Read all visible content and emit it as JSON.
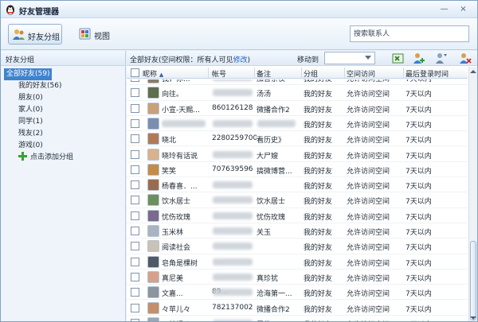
{
  "window": {
    "title": "好友管理器",
    "minimize_glyph": "—",
    "close_glyph": "×",
    "app_icon": "qq-penguin-icon"
  },
  "toolbar": {
    "group_button": {
      "label": "好友分组",
      "icon": "friend-group-icon"
    },
    "view_button": {
      "label": "视图",
      "icon": "view-icon"
    },
    "search": {
      "placeholder": "搜索联系人"
    }
  },
  "sidebar": {
    "heading": "好友分组",
    "groups": [
      {
        "label": "全部好友(59)",
        "selected": true
      },
      {
        "label": "我的好友(56)"
      },
      {
        "label": "朋友(0)"
      },
      {
        "label": "家人(0)"
      },
      {
        "label": "同学(1)"
      },
      {
        "label": "残友(2)"
      },
      {
        "label": "游戏(0)"
      }
    ],
    "add_group_label": "点击添加分组"
  },
  "main": {
    "heading": "全部好友(空间权限：所有人可见",
    "edit_link": "修改",
    "heading_close": ")",
    "move_to_label": "移动到",
    "move_to_value": "",
    "action_icons": [
      "export-excel-icon",
      "add-friend-icon",
      "friend-settings-icon",
      "delete-friend-icon"
    ],
    "columns": {
      "nickname": "昵称",
      "account": "帐号",
      "note": "备注",
      "group": "分组",
      "permission": "空间访问",
      "last_login": "最后登录时间"
    },
    "rows": [
      {
        "nickname": "我，你...",
        "account": "",
        "note": "加普亲仅",
        "group": "我的好友",
        "permission": "允许访问空间",
        "last_login": "7天以内",
        "blur_account": true
      },
      {
        "nickname": "向往。",
        "account": "",
        "note": "汤汤",
        "group": "我的好友",
        "permission": "允许访问空间",
        "last_login": "7天以内",
        "blur_account": true
      },
      {
        "nickname": "小宣-天赐...",
        "account": "860126128",
        "note": "微播合作2",
        "group": "我的好友",
        "permission": "允许访问空间",
        "last_login": "7天以内"
      },
      {
        "nickname": "",
        "account": "",
        "note": "",
        "group": "我的好友",
        "permission": "允许访问空间",
        "last_login": "7天以内",
        "blur_nick": true,
        "blur_account": true,
        "blur_note": true
      },
      {
        "nickname": "晓北",
        "account": "2280259700",
        "note": "看历史》",
        "group": "我的好友",
        "permission": "允许访问空间",
        "last_login": "7天以内"
      },
      {
        "nickname": "晓玲有话说",
        "account": "",
        "note": "大尸嫂",
        "group": "我的好友",
        "permission": "允许访问空间",
        "last_login": "7天以内",
        "blur_account": true
      },
      {
        "nickname": "笑笑",
        "account": "707639596",
        "note": "搞微博营...",
        "group": "我的好友",
        "permission": "允许访问空间",
        "last_login": "7天以内"
      },
      {
        "nickname": "杨春喜．...",
        "account": "",
        "note": "",
        "group": "我的好友",
        "permission": "允许访问空间",
        "last_login": "7天以内",
        "blur_account": true
      },
      {
        "nickname": "饮水居士",
        "account": "",
        "note": "饮水居士",
        "group": "我的好友",
        "permission": "允许访问空间",
        "last_login": "7天以内",
        "blur_account": true
      },
      {
        "nickname": "忧伤玫瑰",
        "account": "",
        "note": "忧伤玫瑰",
        "group": "我的好友",
        "permission": "允许访问空间",
        "last_login": "7天以内",
        "blur_account": true
      },
      {
        "nickname": "玉米林",
        "account": "",
        "note": "关玉",
        "group": "我的好友",
        "permission": "允许访问空间",
        "last_login": "7天以内",
        "blur_account": true
      },
      {
        "nickname": "阅读社会",
        "account": "",
        "note": "",
        "group": "我的好友",
        "permission": "允许访问空间",
        "last_login": "7天以内",
        "blur_account": true
      },
      {
        "nickname": "皂角是棵树",
        "account": "",
        "note": "",
        "group": "我的好友",
        "permission": "允许访问空间",
        "last_login": "7天以内",
        "blur_account": true
      },
      {
        "nickname": "真尼美",
        "account": "",
        "note": "真珍犹",
        "group": "我的好友",
        "permission": "允许访问空间",
        "last_login": "7天以内",
        "blur_account": true
      },
      {
        "nickname": "文嘉...",
        "account": "89...",
        "note": "沧海第一...",
        "group": "我的好友",
        "permission": "允许访问空间",
        "last_login": "7天以内",
        "blur_account": true
      },
      {
        "nickname": "々苹儿々",
        "account": "782137002",
        "note": "微播合作2",
        "group": "我的好友",
        "permission": "允许访问空间",
        "last_login": "7天以内"
      },
      {
        "nickname": "ゞ絆鐳る...",
        "account": "",
        "note": "周俊",
        "group": "我的好友",
        "permission": "允许访问空间",
        "last_login": "7天以内",
        "blur_account": true
      }
    ]
  },
  "colors": {
    "selection": "#3f83cf",
    "link": "#2b63b8",
    "add_icon": "#33a235",
    "header_gradient_top": "#f3f8fd",
    "header_gradient_bottom": "#dfeaf6"
  }
}
